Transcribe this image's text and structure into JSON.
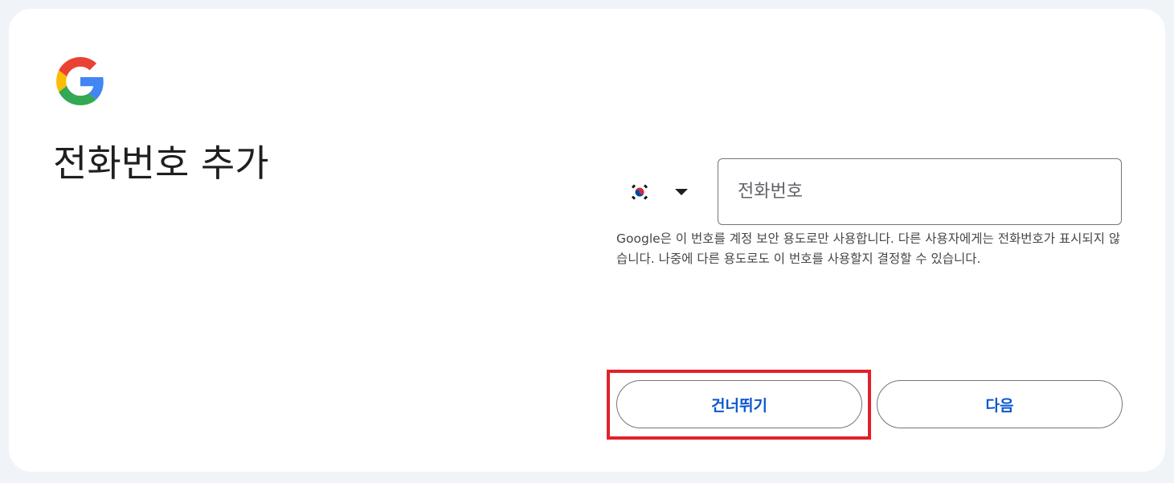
{
  "page": {
    "title": "전화번호 추가"
  },
  "country_selector": {
    "flag": "south-korea-flag",
    "dropdown_icon": "caret-down-icon"
  },
  "phone_field": {
    "value": "",
    "placeholder": "전화번호"
  },
  "helper_text": "Google은 이 번호를 계정 보안 용도로만 사용합니다. 다른 사용자에게는 전화번호가 표시되지 않습니다. 나중에 다른 용도로도 이 번호를 사용할지 결정할 수 있습니다.",
  "buttons": {
    "skip_label": "건너뛰기",
    "next_label": "다음"
  },
  "colors": {
    "background": "#f0f4f9",
    "card": "#ffffff",
    "accent": "#0b57d0",
    "highlight": "#e3202a"
  }
}
